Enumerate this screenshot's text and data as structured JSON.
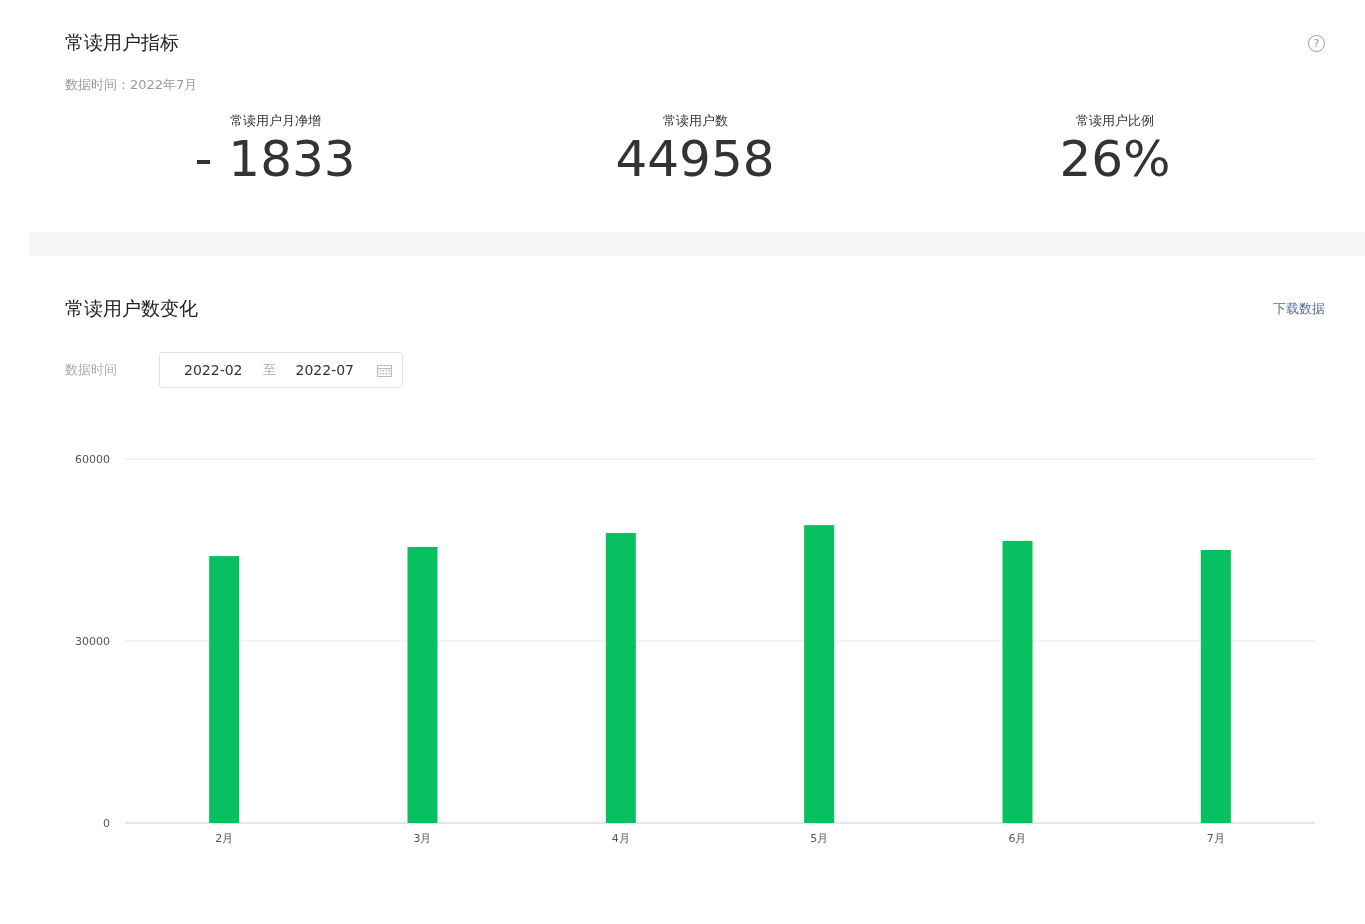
{
  "metrics_panel": {
    "title": "常读用户指标",
    "help": "?",
    "data_time": "数据时间：2022年7月",
    "metrics": [
      {
        "label": "常读用户月净增",
        "value": "- 1833"
      },
      {
        "label": "常读用户数",
        "value": "44958"
      },
      {
        "label": "常读用户比例",
        "value": "26%"
      }
    ]
  },
  "trend_panel": {
    "title": "常读用户数变化",
    "download_link": "下载数据",
    "filter_label": "数据时间",
    "date_range": {
      "start": "2022-02",
      "separator": "至",
      "end": "2022-07"
    },
    "chart_data": {
      "type": "bar",
      "categories": [
        "2月",
        "3月",
        "4月",
        "5月",
        "6月",
        "7月"
      ],
      "series": [
        {
          "color": "#07c160",
          "values": [
            44000,
            45500,
            47800,
            49100,
            46500,
            45000
          ]
        }
      ],
      "ylim": [
        0,
        60000
      ],
      "yticks": [
        0,
        30000,
        60000
      ]
    }
  }
}
